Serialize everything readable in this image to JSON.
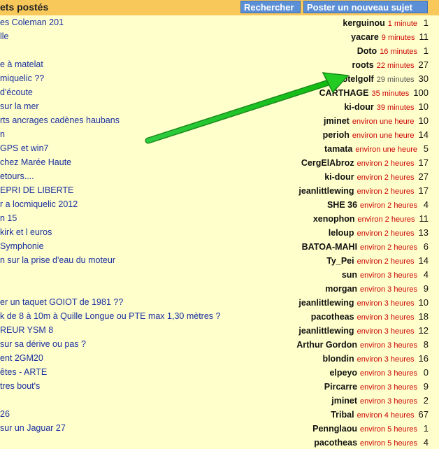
{
  "header": {
    "title": "ets postés",
    "search_label": "Rechercher",
    "new_topic_label": "Poster un nouveau sujet"
  },
  "rows": [
    {
      "topic": "es Coleman 201",
      "author": "kerguinou",
      "time": "1 minute",
      "count": "1"
    },
    {
      "topic": "lle",
      "author": "yacare",
      "time": "9 minutes",
      "count": "11"
    },
    {
      "topic": "",
      "author": "Doto",
      "time": "16 minutes",
      "count": "1"
    },
    {
      "topic": "e à matelat",
      "author": "roots",
      "time": "22 minutes",
      "count": "27"
    },
    {
      "topic": "miquelic ??",
      "author": "hotelgolf",
      "time": "29 minutes",
      "count": "30"
    },
    {
      "topic": "d'écoute",
      "author": "CARTHAGE",
      "time": "35 minutes",
      "count": "100"
    },
    {
      "topic": "sur la mer",
      "author": "ki-dour",
      "time": "39 minutes",
      "count": "10"
    },
    {
      "topic": "rts ancrages cadènes haubans",
      "author": "jminet",
      "time": "environ une heure",
      "count": "10"
    },
    {
      "topic": "n",
      "author": "perioh",
      "time": "environ une heure",
      "count": "14"
    },
    {
      "topic": "GPS et win7",
      "author": "tamata",
      "time": "environ une heure",
      "count": "5"
    },
    {
      "topic": "chez Marée Haute",
      "author": "CergElAbroz",
      "time": "environ 2 heures",
      "count": "17"
    },
    {
      "topic": "etours....",
      "author": "ki-dour",
      "time": "environ 2 heures",
      "count": "27"
    },
    {
      "topic": "EPRI DE LIBERTE",
      "author": "jeanlittlewing",
      "time": "environ 2 heures",
      "count": "17"
    },
    {
      "topic": "r a locmiquelic 2012",
      "author": "SHE 36",
      "time": "environ 2 heures",
      "count": "4"
    },
    {
      "topic": "n 15",
      "author": "xenophon",
      "time": "environ 2 heures",
      "count": "11"
    },
    {
      "topic": "kirk et l euros",
      "author": "leloup",
      "time": "environ 2 heures",
      "count": "13"
    },
    {
      "topic": "Symphonie",
      "author": "BATOA-MAHI",
      "time": "environ 2 heures",
      "count": "6"
    },
    {
      "topic": "n sur la prise d'eau du moteur",
      "author": "Ty_Pei",
      "time": "environ 2 heures",
      "count": "14"
    },
    {
      "topic": "",
      "author": "sun",
      "time": "environ 3 heures",
      "count": "4"
    },
    {
      "topic": "",
      "author": "morgan",
      "time": "environ 3 heures",
      "count": "9"
    },
    {
      "topic": "er un taquet GOIOT de 1981 ??",
      "author": "jeanlittlewing",
      "time": "environ 3 heures",
      "count": "10"
    },
    {
      "topic": "k de 8 à 10m à Quille Longue ou PTE max 1,30 mètres ?",
      "author": "pacotheas",
      "time": "environ 3 heures",
      "count": "18"
    },
    {
      "topic": "REUR YSM 8",
      "author": "jeanlittlewing",
      "time": "environ 3 heures",
      "count": "12"
    },
    {
      "topic": "sur sa dérive ou pas ?",
      "author": "Arthur Gordon",
      "time": "environ 3 heures",
      "count": "8"
    },
    {
      "topic": "ent 2GM20",
      "author": "blondin",
      "time": "environ 3 heures",
      "count": "16"
    },
    {
      "topic": "êtes - ARTE",
      "author": "elpeyo",
      "time": "environ 3 heures",
      "count": "0"
    },
    {
      "topic": "tres bout's",
      "author": "Pircarre",
      "time": "environ 3 heures",
      "count": "9"
    },
    {
      "topic": "",
      "author": "jminet",
      "time": "environ 3 heures",
      "count": "2"
    },
    {
      "topic": "26",
      "author": "Tribal",
      "time": "environ 4 heures",
      "count": "67"
    },
    {
      "topic": "sur un Jaguar 27",
      "author": "Pennglaou",
      "time": "environ 5 heures",
      "count": "1"
    },
    {
      "topic": "",
      "author": "pacotheas",
      "time": "environ 5 heures",
      "count": "4"
    }
  ],
  "highlight_row": 4,
  "colors": {
    "background": "#ffffcc",
    "header": "#f9c85a",
    "button": "#5b8fd6",
    "topic_link": "#1a2fa0",
    "time": "#cc0000",
    "arrow": "#22cc22"
  }
}
